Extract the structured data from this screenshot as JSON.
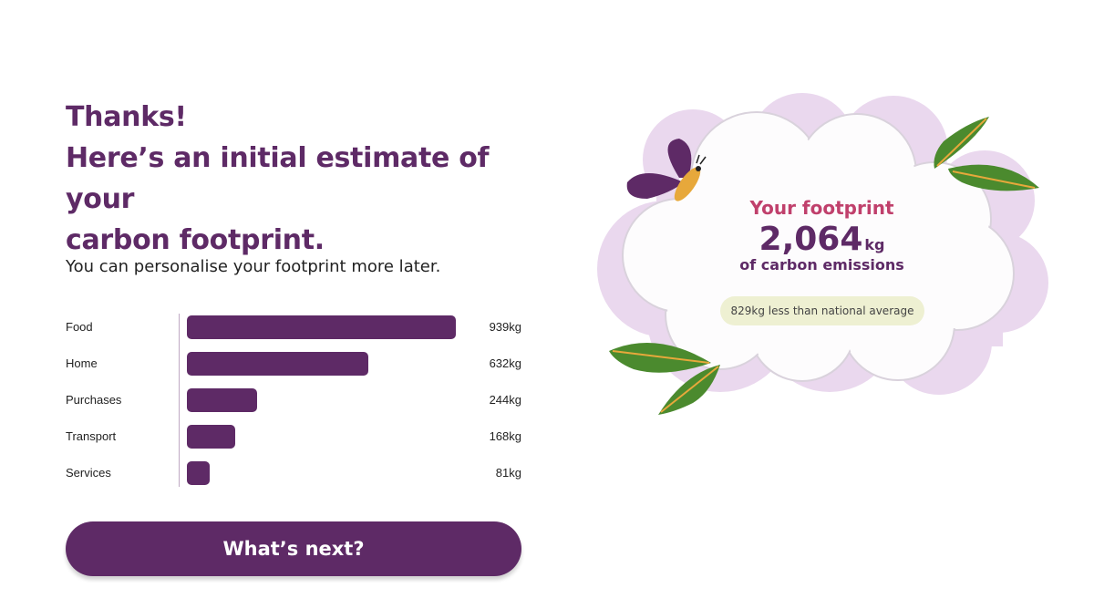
{
  "heading": {
    "line1": "Thanks!",
    "line2": "Here’s an initial estimate of your",
    "line3": "carbon footprint."
  },
  "subtitle": "You can personalise your footprint more later.",
  "chart_data": {
    "type": "bar",
    "orientation": "horizontal",
    "categories": [
      "Food",
      "Home",
      "Purchases",
      "Transport",
      "Services"
    ],
    "values": [
      939,
      632,
      244,
      168,
      81
    ],
    "value_labels": [
      "939kg",
      "632kg",
      "244kg",
      "168kg",
      "81kg"
    ],
    "unit": "kg",
    "bar_color": "#5e2a66"
  },
  "footprint": {
    "title": "Your footprint",
    "value": "2,064",
    "unit": "kg",
    "caption": "of carbon emissions",
    "comparison": "829kg less than national average"
  },
  "next_button": {
    "label": "What’s next?"
  },
  "colors": {
    "brand_purple": "#5e2a66",
    "accent_pink": "#c0406c",
    "cloud_lilac": "#ead8ee",
    "leaf_green": "#4b8a2e",
    "badge_bg": "#eef0d2"
  }
}
